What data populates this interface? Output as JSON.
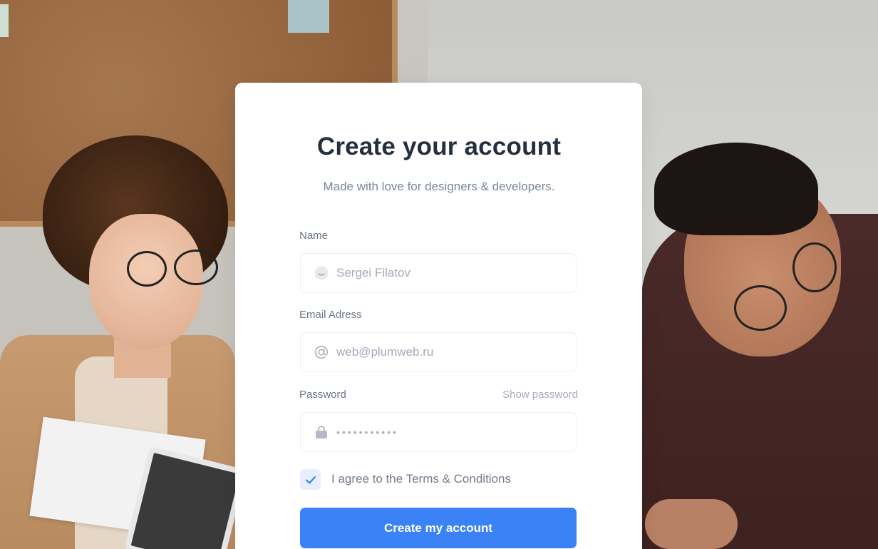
{
  "form": {
    "title": "Create your account",
    "subtitle": "Made with love for designers & developers.",
    "name": {
      "label": "Name",
      "placeholder": "Sergei Filatov",
      "icon": "smile-icon"
    },
    "email": {
      "label": "Email Adress",
      "placeholder": "web@plumweb.ru",
      "icon": "at-icon"
    },
    "password": {
      "label": "Password",
      "show_label": "Show password",
      "value_masked": "•••••••••••",
      "icon": "lock-icon"
    },
    "terms": {
      "checked": true,
      "label": "I agree to the Terms & Conditions"
    },
    "submit_label": "Create my account"
  },
  "colors": {
    "primary": "#3b82f6",
    "heading": "#25303f",
    "muted": "#7c8798",
    "checkbox_bg": "#e7effd"
  }
}
